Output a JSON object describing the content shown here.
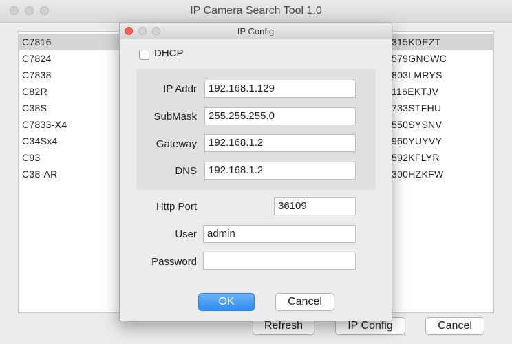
{
  "main_window": {
    "title": "IP Camera Search Tool 1.0",
    "left_list": [
      "C7816",
      "C7824",
      "C7838",
      "C82R",
      "C38S",
      "C7833-X4",
      "C34Sx4",
      "C93",
      "C38-AR"
    ],
    "right_list": [
      "315KDEZT",
      "579GNCWC",
      "803LMRYS",
      "116EKTJV",
      "733STFHU",
      "550SYSNV",
      "960YUYVY",
      "592KFLYR",
      "300HZKFW"
    ],
    "buttons": {
      "refresh": "Refresh",
      "ip_config": "IP Config",
      "cancel": "Cancel"
    }
  },
  "dialog": {
    "title": "IP Config",
    "dhcp_label": "DHCP",
    "dhcp_checked": false,
    "fields": {
      "ip_addr": {
        "label": "IP Addr",
        "value": "192.168.1.129"
      },
      "submask": {
        "label": "SubMask",
        "value": "255.255.255.0"
      },
      "gateway": {
        "label": "Gateway",
        "value": "192.168.1.2"
      },
      "dns": {
        "label": "DNS",
        "value": "192.168.1.2"
      },
      "http_port": {
        "label": "Http Port",
        "value": "36109"
      },
      "user": {
        "label": "User",
        "value": "admin"
      },
      "password": {
        "label": "Password",
        "value": ""
      }
    },
    "ok_label": "OK",
    "cancel_label": "Cancel"
  },
  "colors": {
    "accent": "#2d8cf0",
    "close_red": "#fc5f57",
    "selection": "#d6d6d6"
  }
}
